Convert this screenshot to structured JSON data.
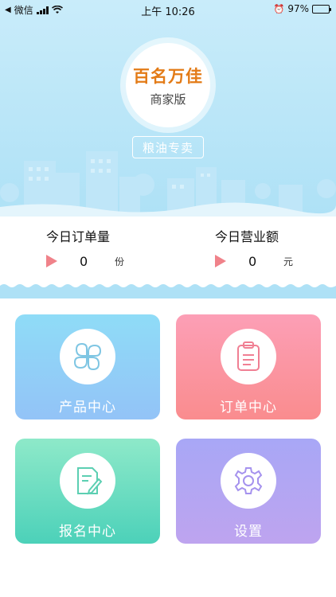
{
  "status_bar": {
    "back_app": "微信",
    "time": "上午 10:26",
    "battery": "97%"
  },
  "header": {
    "brand_name": "百名万佳",
    "edition": "商家版",
    "tag": "粮油专卖"
  },
  "stats": {
    "orders": {
      "title": "今日订单量",
      "value": "0",
      "unit": "份"
    },
    "revenue": {
      "title": "今日营业额",
      "value": "0",
      "unit": "元"
    }
  },
  "menu": {
    "products": "产品中心",
    "orders": "订单中心",
    "signup": "报名中心",
    "settings": "设置"
  },
  "colors": {
    "brand": "#e37b17",
    "accent_triangle": "#f0828a",
    "banner": "#aee1f6"
  }
}
